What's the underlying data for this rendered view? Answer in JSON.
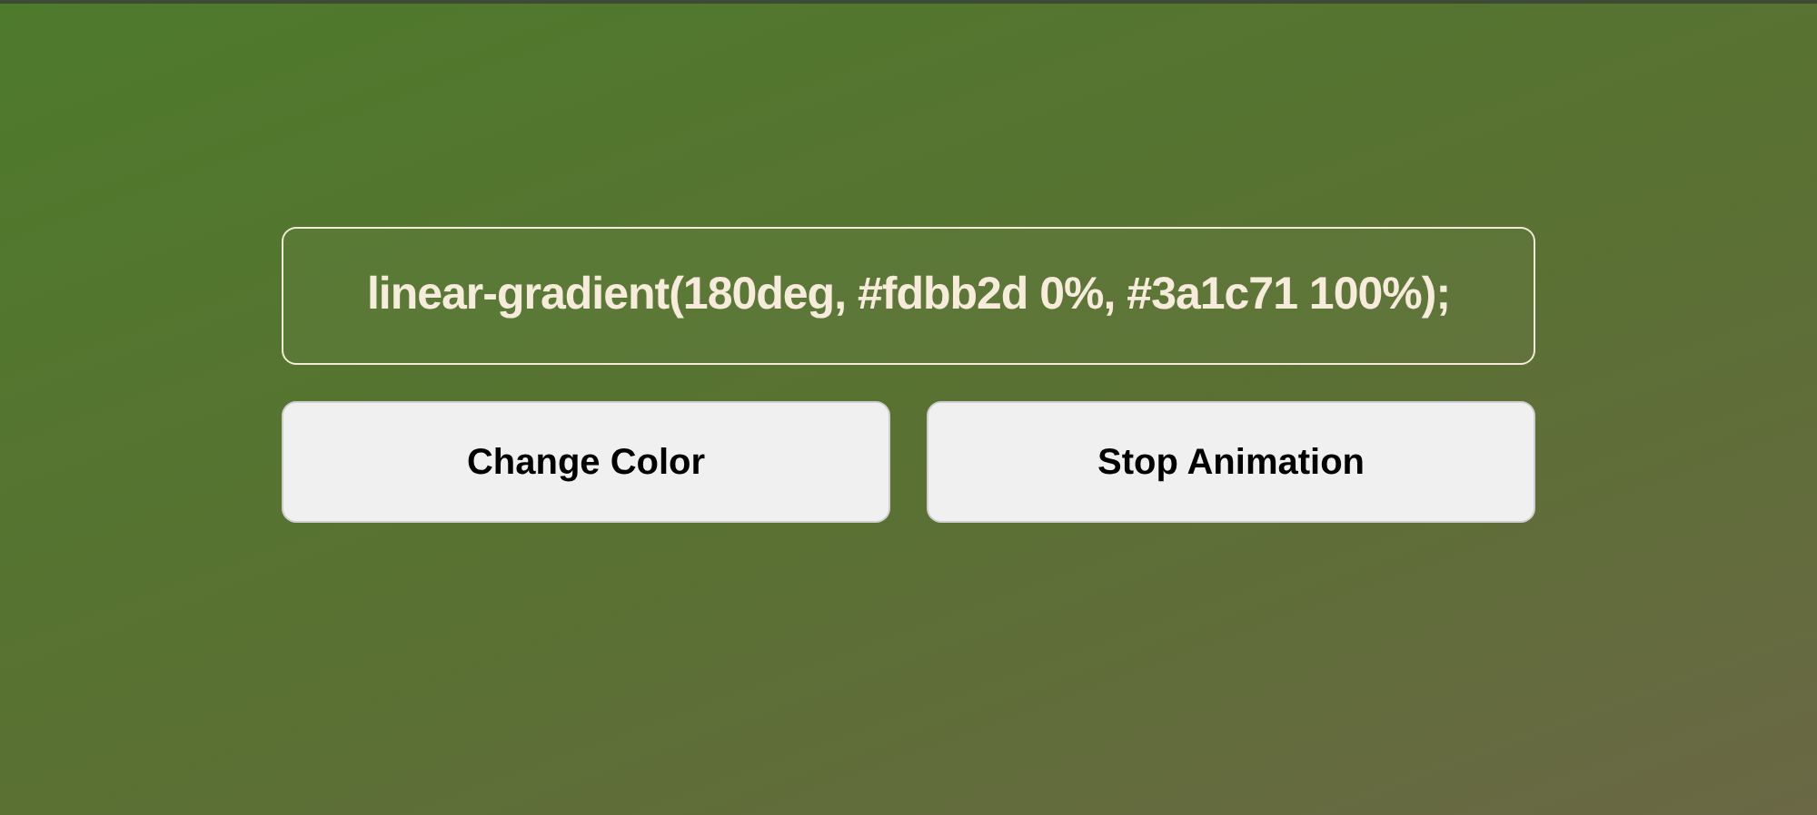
{
  "gradient_display": {
    "text": "linear-gradient(180deg, #fdbb2d 0%, #3a1c71 100%);"
  },
  "buttons": [
    {
      "label": "Change Color"
    },
    {
      "label": "Stop Animation"
    }
  ]
}
